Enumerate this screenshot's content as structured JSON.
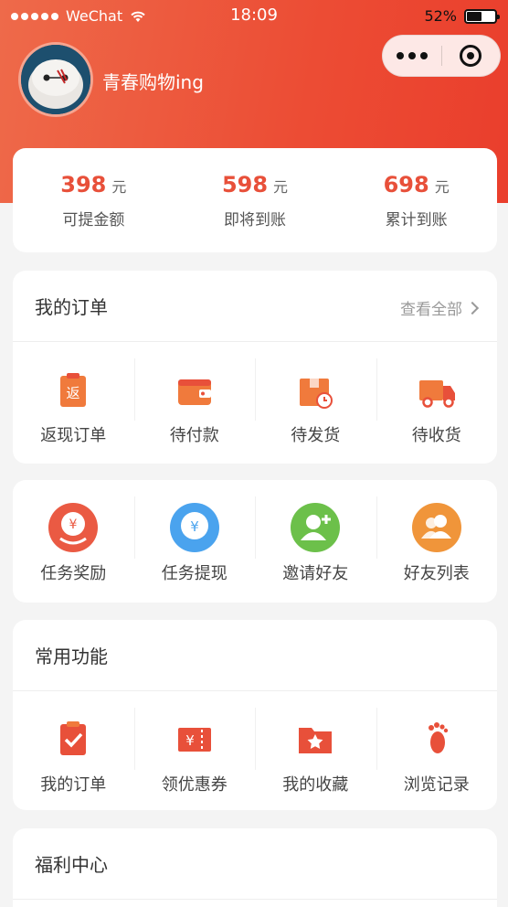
{
  "status_bar": {
    "carrier": "WeChat",
    "time": "18:09",
    "battery": "52%",
    "battery_level": 0.52
  },
  "user": {
    "nickname": "青春购物ing"
  },
  "stats": [
    {
      "amount": "398",
      "unit": "元",
      "label": "可提金额"
    },
    {
      "amount": "598",
      "unit": "元",
      "label": "即将到账"
    },
    {
      "amount": "698",
      "unit": "元",
      "label": "累计到账"
    }
  ],
  "orders": {
    "title": "我的订单",
    "see_all": "查看全部",
    "items": [
      {
        "label": "返现订单",
        "icon": "cashback-order-icon",
        "glyph": "返"
      },
      {
        "label": "待付款",
        "icon": "wallet-icon"
      },
      {
        "label": "待发货",
        "icon": "package-pending-icon"
      },
      {
        "label": "待收货",
        "icon": "delivery-truck-icon"
      }
    ]
  },
  "tasks": {
    "items": [
      {
        "label": "任务奖励",
        "icon": "task-reward-icon",
        "glyph": "¥"
      },
      {
        "label": "任务提现",
        "icon": "task-withdraw-icon",
        "glyph": "¥"
      },
      {
        "label": "邀请好友",
        "icon": "invite-friend-icon"
      },
      {
        "label": "好友列表",
        "icon": "friend-list-icon"
      }
    ]
  },
  "common": {
    "title": "常用功能",
    "items": [
      {
        "label": "我的订单",
        "icon": "order-clipboard-icon"
      },
      {
        "label": "领优惠券",
        "icon": "coupon-icon",
        "glyph": "¥"
      },
      {
        "label": "我的收藏",
        "icon": "favorites-icon"
      },
      {
        "label": "浏览记录",
        "icon": "footprint-icon"
      }
    ]
  },
  "welfare": {
    "title": "福利中心"
  },
  "colors": {
    "accent": "#e8503a",
    "header_start": "#ee6a4a",
    "header_end": "#ea3e2c",
    "blue": "#4aa3ee",
    "green": "#6cc04a",
    "orange": "#f0953a"
  }
}
